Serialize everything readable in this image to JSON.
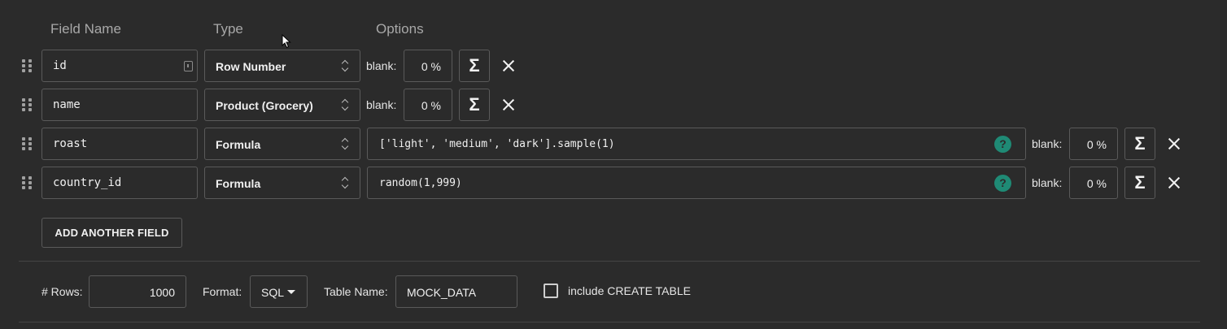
{
  "headers": {
    "field_name": "Field Name",
    "type": "Type",
    "options": "Options"
  },
  "fields": [
    {
      "name": "id",
      "type": "Row Number",
      "blank_label": "blank:",
      "blank": "0 %",
      "formula": ""
    },
    {
      "name": "name",
      "type": "Product (Grocery)",
      "blank_label": "blank:",
      "blank": "0 %",
      "formula": ""
    },
    {
      "name": "roast",
      "type": "Formula",
      "blank_label": "blank:",
      "blank": "0 %",
      "formula": "['light', 'medium', 'dark'].sample(1)"
    },
    {
      "name": "country_id",
      "type": "Formula",
      "blank_label": "blank:",
      "blank": "0 %",
      "formula": "random(1,999)"
    }
  ],
  "sigma_symbol": "Σ",
  "help_symbol": "?",
  "add_button": "ADD ANOTHER FIELD",
  "footer": {
    "rows_label": "# Rows:",
    "rows_value": "1000",
    "format_label": "Format:",
    "format_value": "SQL",
    "table_name_label": "Table Name:",
    "table_name_value": "MOCK_DATA",
    "create_table_label": "include CREATE TABLE",
    "create_table_checked": false
  },
  "colors": {
    "background": "#2b2b2b",
    "border": "#5a5a5a",
    "help_accent": "#1f8a75"
  },
  "icons": [
    "drag-handle-icon",
    "key-icon",
    "chevron-updown-icon",
    "sigma-icon",
    "close-icon",
    "help-icon",
    "caret-down-icon",
    "mouse-cursor-icon"
  ]
}
